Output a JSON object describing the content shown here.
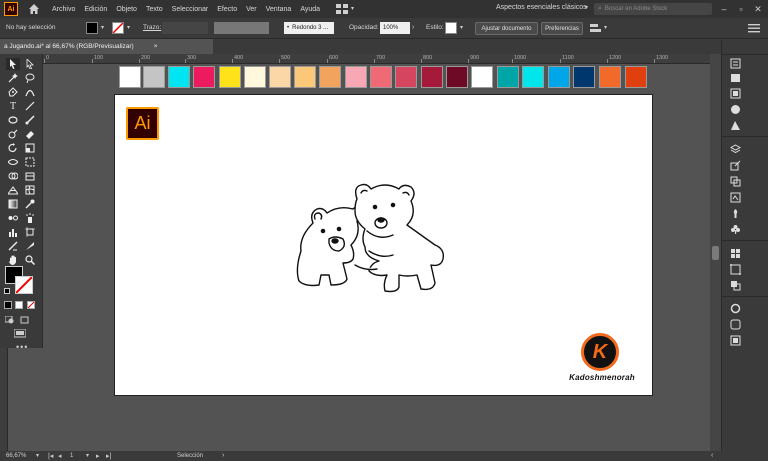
{
  "app": {
    "logo": "Ai"
  },
  "menu": [
    "Archivo",
    "Edición",
    "Objeto",
    "Texto",
    "Seleccionar",
    "Efecto",
    "Ver",
    "Ventana",
    "Ayuda"
  ],
  "workspace": "Aspectos esenciales clásicos",
  "search": {
    "placeholder": "Buscar en Adobe Stock"
  },
  "control": {
    "selection": "No hay selección",
    "stroke_label": "Trazo:",
    "brush": "Redondo 3 ...",
    "opacity_label": "Opacidad:",
    "opacity_value": "100%",
    "style_label": "Estilo:",
    "adjust_btn": "Ajustar documento",
    "prefs_btn": "Preferencias"
  },
  "tab": {
    "title": "a Jugando.ai* al 66,67% (RGB/Previsualizar)",
    "close": "×"
  },
  "ruler": [
    "0",
    "100",
    "200",
    "300",
    "400",
    "500",
    "600",
    "700",
    "800",
    "900",
    "1000",
    "1100",
    "1200",
    "1300"
  ],
  "swatches": [
    "#ffffff",
    "#c4c4c4",
    "#00e5f2",
    "#ec1a5e",
    "#ffe21a",
    "#fff8dc",
    "#fbd7a8",
    "#fac878",
    "#f2a35e",
    "#f8a8b4",
    "#ef6a75",
    "#d64560",
    "#a51a3a",
    "#6e0a26",
    "#ffffff",
    "#00a5a8",
    "#00e6ea",
    "#00a6e8",
    "#00386e",
    "#f26a2a",
    "#e04010"
  ],
  "artboard": {
    "badge_text": "Ai",
    "badge_color": "#ff9a00",
    "signature": "Kadoshmenorah",
    "k_logo": "K"
  },
  "status": {
    "zoom": "66,67%",
    "artboard_num": "1",
    "tool": "Selección"
  },
  "colors": {
    "chrome": "#323232",
    "panel": "#3a3a3a",
    "workspace": "#535353",
    "accent": "#ff9a00"
  }
}
